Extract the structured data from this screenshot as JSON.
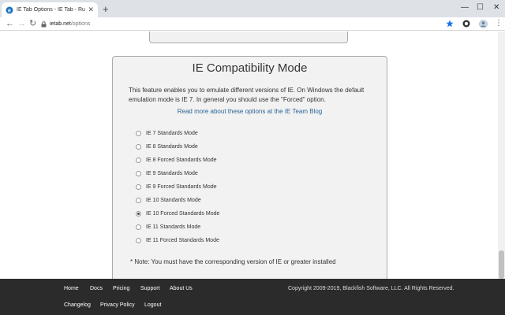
{
  "browser": {
    "tab_title": "IE Tab Options - IE Tab - Run Inter",
    "url_host": "ietab.net",
    "url_path": "/options"
  },
  "compat": {
    "heading": "IE Compatibility Mode",
    "description": "This feature enables you to emulate different versions of IE. On Windows the default emulation mode is IE 7. In general you should use the \"Forced\" option.",
    "read_more": "Read more about these options at the IE Team Blog",
    "options": [
      {
        "label": "IE 7 Standards Mode",
        "checked": false
      },
      {
        "label": "IE 8 Standards Mode",
        "checked": false
      },
      {
        "label": "IE 8 Forced Standards Mode",
        "checked": false
      },
      {
        "label": "IE 9 Standards Mode",
        "checked": false
      },
      {
        "label": "IE 9 Forced Standards Mode",
        "checked": false
      },
      {
        "label": "IE 10 Standards Mode",
        "checked": false
      },
      {
        "label": "IE 10 Forced Standards Mode",
        "checked": true
      },
      {
        "label": "IE 11 Standards Mode",
        "checked": false
      },
      {
        "label": "IE 11 Forced Standards Mode",
        "checked": false
      }
    ],
    "note": "* Note: You must have the corresponding version of IE or greater installed"
  },
  "footer": {
    "row1": [
      "Home",
      "Docs",
      "Pricing",
      "Support",
      "About Us"
    ],
    "row2": [
      "Changelog",
      "Privacy Policy",
      "Logout"
    ],
    "copyright": "Copyright 2009-2019, Blackfish Software, LLC. All Rights Reserved."
  },
  "colors": {
    "link": "#2a6496",
    "footer_bg": "#2b2b2b",
    "panel_bg": "#f2f2f2",
    "chrome_bg": "#dee1e6"
  },
  "icons": [
    "ie-tab-favicon",
    "close-icon",
    "new-tab-icon",
    "minimize-icon",
    "maximize-icon",
    "window-close-icon",
    "back-icon",
    "forward-icon",
    "reload-icon",
    "lock-icon",
    "bookmark-star-icon",
    "extension-icon",
    "profile-avatar-icon",
    "menu-icon"
  ]
}
